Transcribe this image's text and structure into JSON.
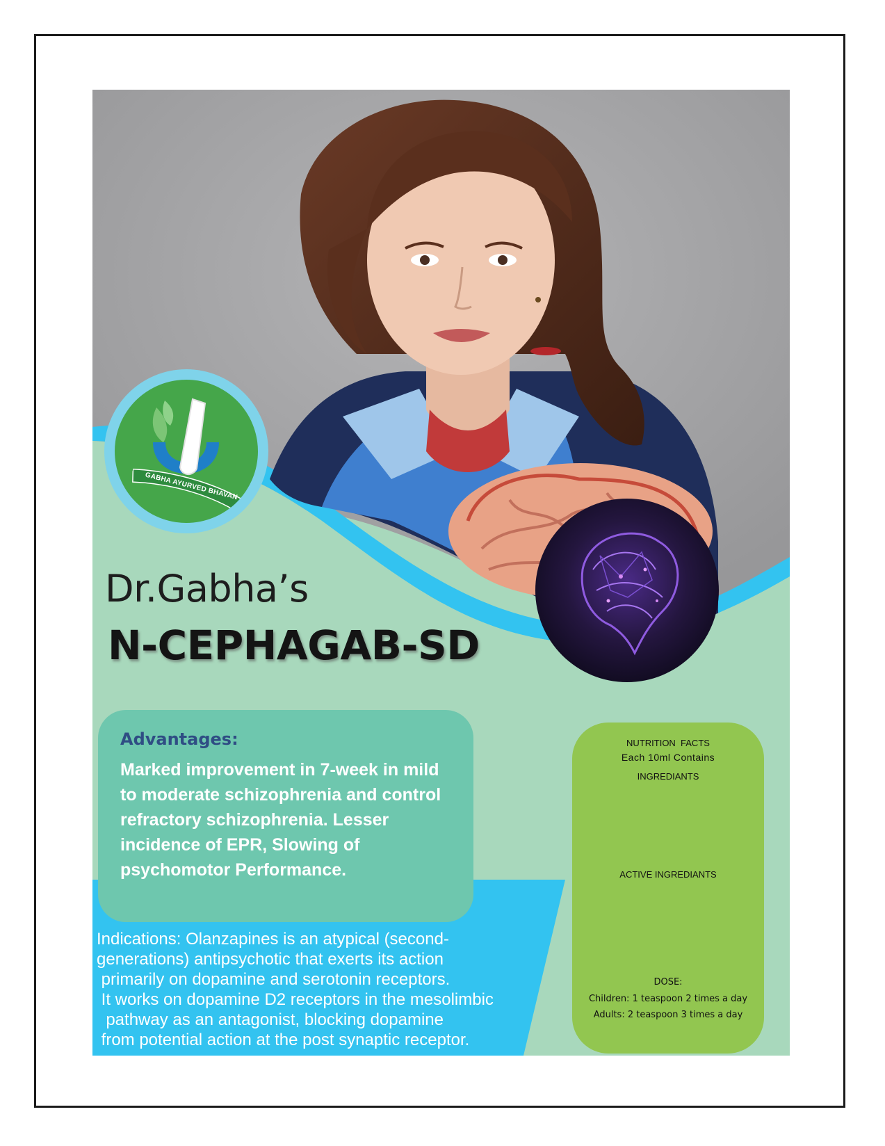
{
  "logo": {
    "ribbon_text": "GABHA AYURVED BHAVAN"
  },
  "brand_name": "Dr.Gabha’s",
  "product_name": "N-CEPHAGAB-SD",
  "advantages": {
    "title": "Advantages:",
    "text": "Marked improvement in 7-week in mild to moderate schizophrenia and control refractory schizophrenia. Lesser incidence of EPR, Slowing of psychomotor Performance."
  },
  "indications": {
    "lines": [
      "Indications: Olanzapines is an atypical (second-",
      "generations) antipsychotic that exerts its action",
      " primarily on dopamine and serotonin receptors.",
      " It works on dopamine D2 receptors in the mesolimbic",
      "  pathway as an antagonist, blocking dopamine",
      " from potential action at the post synaptic receptor."
    ]
  },
  "nutrition": {
    "title": "NUTRITION  FACTS",
    "subtitle": "Each 10ml Contains",
    "ingredients_label": "INGREDIANTS",
    "active_label": "ACTIVE INGREDIANTS",
    "dose_label": "DOSE:",
    "children": "Children: 1 teaspoon 2 times a day",
    "adults": "Adults: 2 teaspoon 3 times a day"
  },
  "colors": {
    "sky_blue": "#33c3f0",
    "mint": "#a8d8bc",
    "teal_box": "#6ec7ae",
    "green_box": "#92c650",
    "logo_green": "#45a64a",
    "backdrop_gray": "#a7a7a9",
    "title_blue": "#2f4d84"
  }
}
